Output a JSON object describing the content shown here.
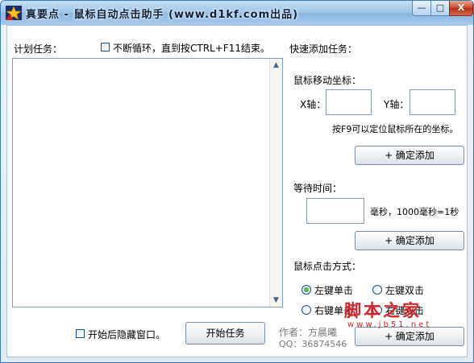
{
  "window": {
    "title": "真要点 - 鼠标自动点击助手 (www.d1kf.com出品)",
    "min_glyph": "—",
    "max_glyph": "□",
    "close_glyph": "X"
  },
  "task_list": {
    "label": "计划任务：",
    "loop_checkbox_label": "不断循环，直到按CTRL+F11结束。",
    "loop_checked": false
  },
  "quick_add": {
    "heading": "快速添加任务：",
    "move": {
      "label": "鼠标移动坐标：",
      "x_label": "X轴：",
      "y_label": "Y轴：",
      "x_value": "",
      "y_value": "",
      "hint": "按F9可以定位鼠标所在的坐标。",
      "add_button": "+ 确定添加"
    },
    "wait": {
      "label": "等待时间：",
      "value": "",
      "hint": "毫秒，1000毫秒=1秒",
      "add_button": "+ 确定添加"
    },
    "click": {
      "label": "鼠标点击方式：",
      "options": [
        "左键单击",
        "左键双击",
        "右键单击",
        "右键双击"
      ],
      "selected": "左键单击",
      "add_button": "+ 确定添加"
    }
  },
  "footer": {
    "hide_checkbox_label": "开始后隐藏窗口。",
    "hide_checked": false,
    "start_button": "开始任务",
    "author": "作者：方晨曦",
    "qq": "QQ：36874546"
  },
  "watermark": {
    "text": "脚本之家",
    "url": "www.jb51.net"
  },
  "colors": {
    "titlebar": "#9cc4e8",
    "border": "#3d7ab8",
    "close": "#c8452a",
    "watermark": "#d1252a"
  }
}
